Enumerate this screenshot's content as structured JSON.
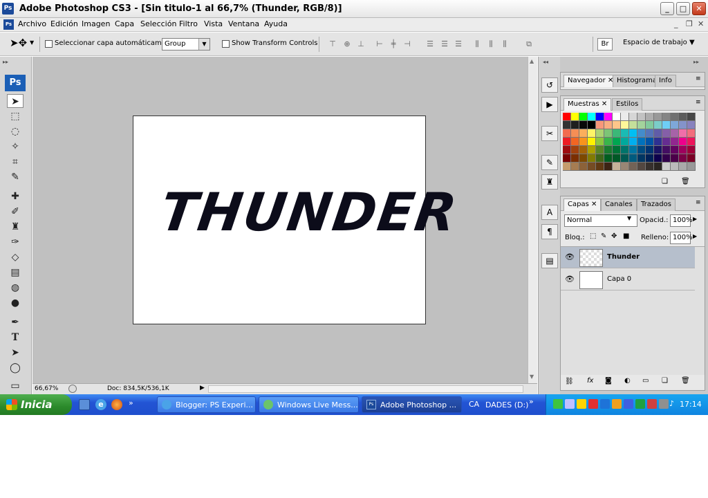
{
  "window": {
    "title": "Adobe Photoshop CS3 - [Sin titulo-1 al 66,7% (Thunder, RGB/8)]",
    "app_icon": "Ps",
    "min": "_",
    "max": "□",
    "close": "✕"
  },
  "menu": {
    "items": [
      "Archivo",
      "Edición",
      "Imagen",
      "Capa",
      "Selección",
      "Filtro",
      "Vista",
      "Ventana",
      "Ayuda"
    ],
    "mdi": {
      "min": "_",
      "restore": "❐",
      "close": "✕"
    }
  },
  "options": {
    "auto_select_label": "Seleccionar capa automáticamente",
    "group_value": "Group",
    "transform_label": "Show Transform Controls",
    "workspace_label": "Espacio de trabajo ▼"
  },
  "tools": {
    "logo": "Ps"
  },
  "canvas": {
    "text": "THUNDER"
  },
  "status": {
    "zoom": "66,67%",
    "doc": "Doc: 834,5K/536,1K"
  },
  "panels": {
    "nav_tabs": [
      "Navegador",
      "Histograma",
      "Info"
    ],
    "swatch_tabs": [
      "Muestras",
      "Estilos"
    ],
    "layer_tabs": [
      "Capas",
      "Canales",
      "Trazados"
    ],
    "blend_mode": "Normal",
    "opacity_label": "Opacid.:",
    "opacity_value": "100%",
    "lock_label": "Bloq.:",
    "fill_label": "Relleno:",
    "fill_value": "100%",
    "layers": [
      {
        "name": "Thunder"
      },
      {
        "name": "Capa 0"
      }
    ],
    "swatch_colors": [
      "#ff0000",
      "#ffff00",
      "#00ff00",
      "#00ffff",
      "#0000ff",
      "#ff00ff",
      "#ffffff",
      "#ebebeb",
      "#d6d6d6",
      "#c2c2c2",
      "#adadad",
      "#999999",
      "#858585",
      "#707070",
      "#5c5c5c",
      "#474747",
      "#333333",
      "#1f1f1f",
      "#0a0a0a",
      "#000000",
      "#f7977a",
      "#f9ad81",
      "#fdc68a",
      "#fff79a",
      "#c4df9b",
      "#a3d39c",
      "#82ca9d",
      "#7bcdc8",
      "#6ecff6",
      "#7ea7d8",
      "#8493ca",
      "#8882be",
      "#f26c4f",
      "#f68e55",
      "#fbaf5c",
      "#fff467",
      "#acd372",
      "#7cc576",
      "#3bb878",
      "#1abbb4",
      "#00bff3",
      "#438ccb",
      "#5574b9",
      "#605ca8",
      "#855fa8",
      "#a763a8",
      "#f06ea9",
      "#f26d7d",
      "#ed1c24",
      "#f26522",
      "#f7941d",
      "#fff200",
      "#8dc73f",
      "#39b54a",
      "#00a651",
      "#00a99d",
      "#00aeef",
      "#0072bc",
      "#0054a6",
      "#2e3192",
      "#662d91",
      "#92278f",
      "#ec008c",
      "#ed145b",
      "#9e0b0f",
      "#a0410d",
      "#a36209",
      "#aba000",
      "#598527",
      "#1a7b30",
      "#007236",
      "#00746b",
      "#0076a3",
      "#004b80",
      "#003471",
      "#1b1464",
      "#440e62",
      "#630460",
      "#9e005d",
      "#9e0039",
      "#790000",
      "#7b2e00",
      "#7d4900",
      "#827b00",
      "#406618",
      "#005e20",
      "#005826",
      "#005952",
      "#005b7f",
      "#003663",
      "#002157",
      "#0d004c",
      "#32004b",
      "#4b0049",
      "#7b0046",
      "#7a0026",
      "#c69c6d",
      "#a67c52",
      "#8c6239",
      "#754c24",
      "#603913",
      "#3c2415",
      "#c7b299",
      "#998675",
      "#736357",
      "#534741",
      "#37302d",
      "#2a2522",
      "#cccccc",
      "#bbbbbb",
      "#aaaaaa",
      "#999999"
    ]
  },
  "taskbar": {
    "start": "Inicia",
    "tasks": [
      {
        "label": "Blogger: PS Experi..."
      },
      {
        "label": "Windows Live Mess..."
      },
      {
        "label": "Adobe Photoshop ..."
      },
      {
        "label": "DADES (D:)"
      }
    ],
    "tray_prefix": "CA",
    "clock": "17:14"
  },
  "colors": {
    "canvas_bg": "#c0c0c0",
    "taskbar": "#2354d4",
    "start": "#2b8a2b"
  }
}
